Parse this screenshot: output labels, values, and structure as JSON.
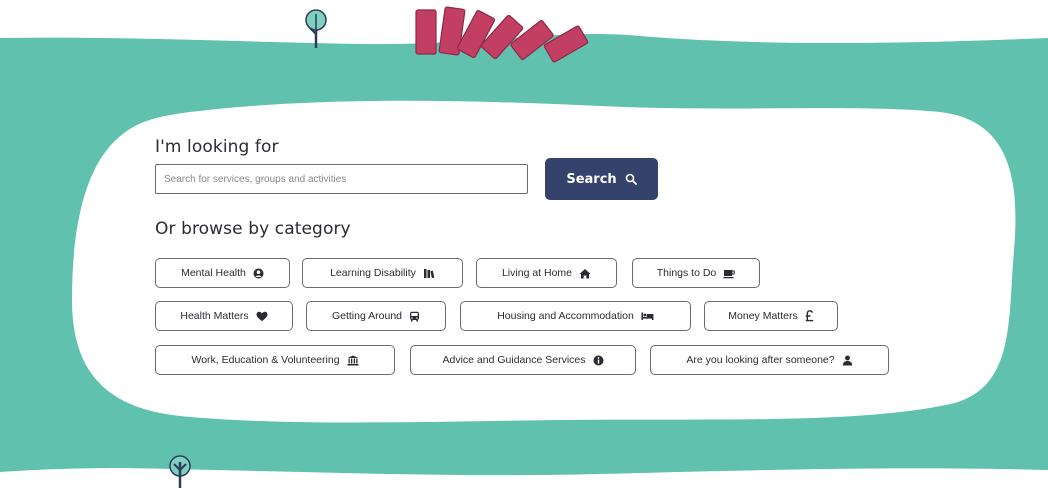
{
  "search": {
    "heading": "I'm looking for",
    "placeholder": "Search for services, groups and activities",
    "button_label": "Search"
  },
  "browse": {
    "heading": "Or browse by category",
    "categories": [
      {
        "label": "Mental Health",
        "icon": "brain-icon"
      },
      {
        "label": "Learning Disability",
        "icon": "books-icon"
      },
      {
        "label": "Living at Home",
        "icon": "home-icon"
      },
      {
        "label": "Things to Do",
        "icon": "coffee-icon"
      },
      {
        "label": "Health Matters",
        "icon": "heart-icon"
      },
      {
        "label": "Getting Around",
        "icon": "bus-icon"
      },
      {
        "label": "Housing and Accommodation",
        "icon": "bed-icon"
      },
      {
        "label": "Money Matters",
        "icon": "pound-icon"
      },
      {
        "label": "Work, Education & Volunteering",
        "icon": "institution-icon"
      },
      {
        "label": "Advice and Guidance Services",
        "icon": "info-icon"
      },
      {
        "label": "Are you looking after someone?",
        "icon": "user-icon"
      }
    ]
  },
  "colors": {
    "background_green": "#5fc1ae",
    "panel_white": "#ffffff",
    "button_navy": "#35426b",
    "book_red": "#c23e62",
    "tree_teal": "#5fc1ae",
    "text_dark": "#2b2b33"
  }
}
